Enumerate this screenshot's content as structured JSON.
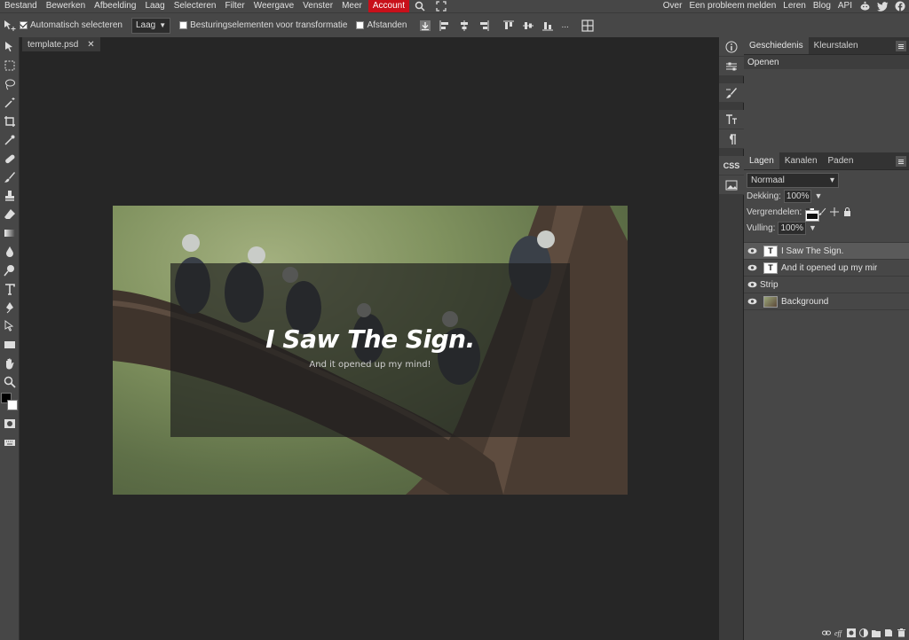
{
  "menu": {
    "items": [
      "Bestand",
      "Bewerken",
      "Afbeelding",
      "Laag",
      "Selecteren",
      "Filter",
      "Weergave",
      "Venster",
      "Meer"
    ],
    "account": "Account",
    "right_items": [
      "Over",
      "Een probleem melden",
      "Leren",
      "Blog",
      "API"
    ]
  },
  "options": {
    "auto_select_label": "Automatisch selecteren",
    "auto_select_checked": true,
    "target_select": "Laag",
    "transform_controls_label": "Besturingselementen voor transformatie",
    "transform_controls_checked": false,
    "distances_label": "Afstanden",
    "distances_checked": false,
    "more": "..."
  },
  "document": {
    "tab_title": "template.psd",
    "canvas_title": "I Saw The Sign.",
    "canvas_subtitle": "And it opened up my mind!"
  },
  "sidecol": {
    "css_label": "CSS"
  },
  "panels": {
    "top_tabs": [
      "Geschiedenis",
      "Kleurstalen"
    ],
    "history_items": [
      "Openen"
    ],
    "layer_tabs": [
      "Lagen",
      "Kanalen",
      "Paden"
    ],
    "blend_mode": "Normaal",
    "opacity_label": "Dekking:",
    "opacity_value": "100%",
    "lock_label": "Vergrendelen:",
    "fill_label": "Vulling:",
    "fill_value": "100%",
    "layers": [
      {
        "name": "I Saw The Sign.",
        "type": "text",
        "selected": true
      },
      {
        "name": "And it opened up my mir",
        "type": "text",
        "selected": false
      },
      {
        "name": "Strip",
        "type": "strip",
        "selected": false
      },
      {
        "name": "Background",
        "type": "image",
        "selected": false
      }
    ]
  },
  "colors": {
    "accent": "#c8101a",
    "bg_dark": "#262626",
    "panel": "#474747"
  }
}
